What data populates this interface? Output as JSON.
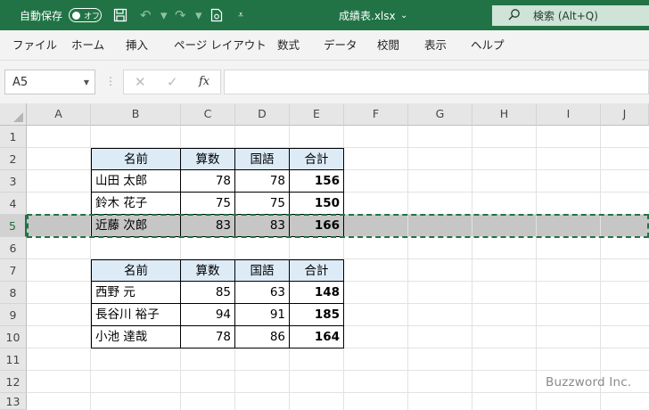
{
  "titlebar": {
    "autosave_label": "自動保存",
    "autosave_state": "オフ",
    "filename": "成績表.xlsx",
    "search_label": "検索 (Alt+Q)",
    "icons": [
      "save-icon",
      "undo-icon",
      "redo-icon",
      "print-preview-icon",
      "customize-qat-icon"
    ]
  },
  "menu": {
    "items": [
      "ファイル",
      "ホーム",
      "挿入",
      "ページ レイアウト",
      "数式",
      "データ",
      "校閲",
      "表示",
      "ヘルプ"
    ]
  },
  "formula_bar": {
    "name_box": "A5",
    "cancel_symbol": "✕",
    "enter_symbol": "✓",
    "fx_label": "fx",
    "formula": ""
  },
  "sheet": {
    "columns": [
      "A",
      "B",
      "C",
      "D",
      "E",
      "F",
      "G",
      "H",
      "I",
      "J"
    ],
    "rows": [
      "1",
      "2",
      "3",
      "4",
      "5",
      "6",
      "7",
      "8",
      "9",
      "10",
      "11",
      "12",
      "13"
    ],
    "selected_row": "5",
    "table1": {
      "header": [
        "名前",
        "算数",
        "国語",
        "合計"
      ],
      "rows": [
        [
          "山田 太郎",
          "78",
          "78",
          "156"
        ],
        [
          "鈴木 花子",
          "75",
          "75",
          "150"
        ],
        [
          "近藤 次郎",
          "83",
          "83",
          "166"
        ]
      ]
    },
    "table2": {
      "header": [
        "名前",
        "算数",
        "国語",
        "合計"
      ],
      "rows": [
        [
          "西野 元",
          "85",
          "63",
          "148"
        ],
        [
          "長谷川 裕子",
          "94",
          "91",
          "185"
        ],
        [
          "小池 達哉",
          "78",
          "86",
          "164"
        ]
      ]
    }
  },
  "watermark": "Buzzword Inc.",
  "colors": {
    "accent": "#217346",
    "table_header_fill": "#ddebf7",
    "selected_row_fill": "#c6c6c6"
  }
}
